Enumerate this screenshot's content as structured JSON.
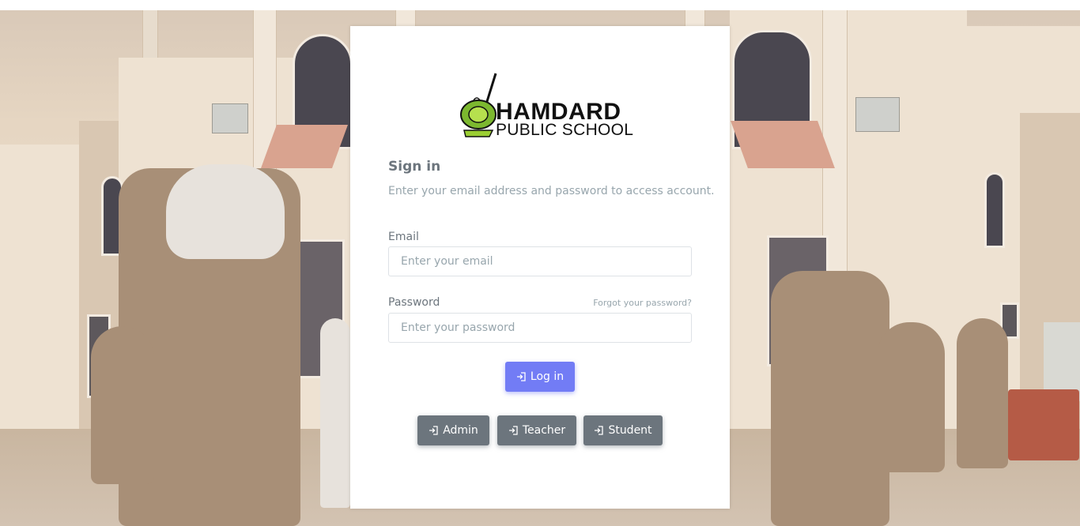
{
  "logo": {
    "line1": "HAMDARD",
    "line2": "PUBLIC SCHOOL"
  },
  "signin": {
    "title": "Sign in",
    "subtitle": "Enter your email address and password to access account."
  },
  "form": {
    "email_label": "Email",
    "email_placeholder": "Enter your email",
    "password_label": "Password",
    "password_placeholder": "Enter your password",
    "forgot_label": "Forgot your password?",
    "login_label": "Log in"
  },
  "roles": {
    "admin_label": "Admin",
    "teacher_label": "Teacher",
    "student_label": "Student"
  },
  "colors": {
    "primary": "#727cf5",
    "secondary": "#6c757d",
    "text_muted": "#98a6ad"
  },
  "icons": {
    "login": "login-icon"
  }
}
